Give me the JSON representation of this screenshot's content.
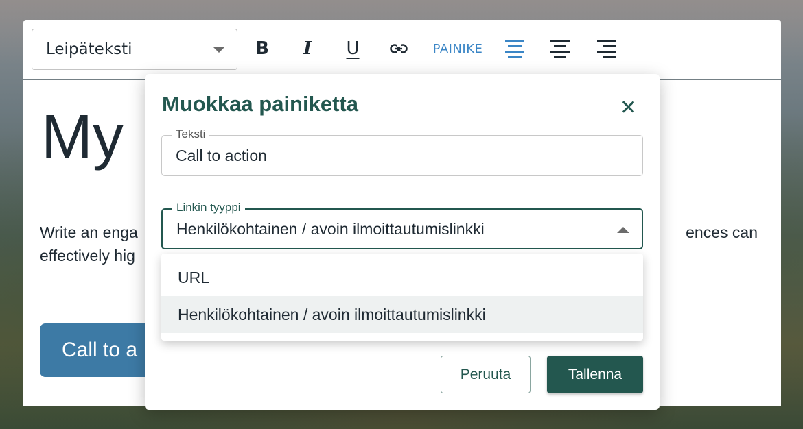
{
  "toolbar": {
    "style_select_value": "Leipäteksti",
    "bold_label": "B",
    "italic_label": "I",
    "underline_label": "U",
    "painike_label": "PAINIKE"
  },
  "content": {
    "title": "My",
    "body_line1": "Write an enga",
    "body_line2": "effectively hig",
    "body_right": "ences can",
    "cta_label": "Call to a"
  },
  "dialog": {
    "title": "Muokkaa painiketta",
    "text_field": {
      "label": "Teksti",
      "value": "Call to action"
    },
    "link_type_field": {
      "label": "Linkin tyyppi",
      "value": "Henkilökohtainen / avoin ilmoittautumislinkki"
    },
    "link_type_options": [
      "URL",
      "Henkilökohtainen / avoin ilmoittautumislinkki"
    ],
    "cancel_label": "Peruuta",
    "save_label": "Tallenna"
  }
}
